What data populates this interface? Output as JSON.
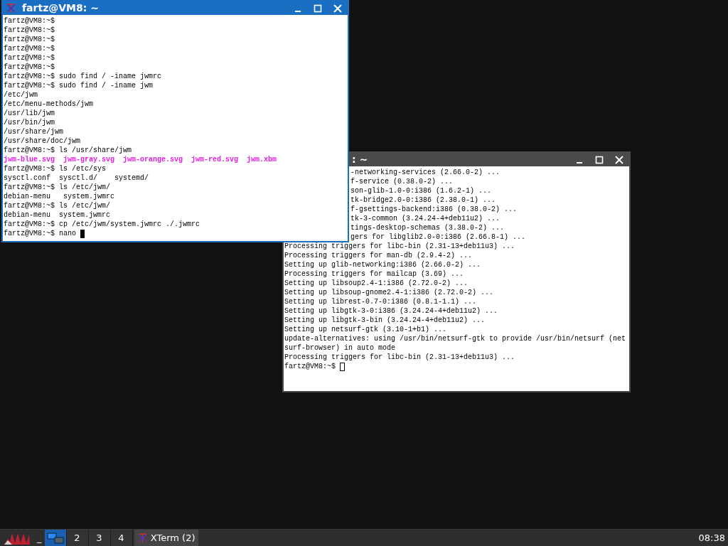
{
  "windows": [
    {
      "title": ": ~",
      "focused": false,
      "lines": [
        {
          "kind": "partial",
          "text": "-networking-services (2.66.0-2) ..."
        },
        {
          "kind": "partial",
          "text": "f-service (0.38.0-2) ..."
        },
        {
          "kind": "partial",
          "text": "son-glib-1.0-0:i386 (1.6.2-1) ..."
        },
        {
          "kind": "partial",
          "text": "tk-bridge2.0-0:i386 (2.38.0-1) ..."
        },
        {
          "kind": "partial",
          "text": "f-gsettings-backend:i386 (0.38.0-2) ..."
        },
        {
          "kind": "partial",
          "text": "tk-3-common (3.24.24-4+deb11u2) ..."
        },
        {
          "kind": "partial",
          "text": "tings-desktop-schemas (3.38.0-2) ..."
        },
        {
          "kind": "partial",
          "text": "gers for libglib2.0-0:i386 (2.66.8-1) ..."
        },
        {
          "kind": "text",
          "text": "Processing triggers for libc-bin (2.31-13+deb11u3) ..."
        },
        {
          "kind": "text",
          "text": "Processing triggers for man-db (2.9.4-2) ..."
        },
        {
          "kind": "text",
          "text": "Setting up glib-networking:i386 (2.66.0-2) ..."
        },
        {
          "kind": "text",
          "text": "Processing triggers for mailcap (3.69) ..."
        },
        {
          "kind": "text",
          "text": "Setting up libsoup2.4-1:i386 (2.72.0-2) ..."
        },
        {
          "kind": "text",
          "text": "Setting up libsoup-gnome2.4-1:i386 (2.72.0-2) ..."
        },
        {
          "kind": "text",
          "text": "Setting up librest-0.7-0:i386 (0.8.1-1.1) ..."
        },
        {
          "kind": "text",
          "text": "Setting up libgtk-3-0:i386 (3.24.24-4+deb11u2) ..."
        },
        {
          "kind": "text",
          "text": "Setting up libgtk-3-bin (3.24.24-4+deb11u2) ..."
        },
        {
          "kind": "text",
          "text": "Setting up netsurf-gtk (3.10-1+b1) ..."
        },
        {
          "kind": "text",
          "text": "update-alternatives: using /usr/bin/netsurf-gtk to provide /usr/bin/netsurf (net"
        },
        {
          "kind": "text",
          "text": "surf-browser) in auto mode"
        },
        {
          "kind": "text",
          "text": "Processing triggers for libc-bin (2.31-13+deb11u3) ..."
        },
        {
          "kind": "prompt",
          "text": "fartz@VM8:~$ "
        }
      ]
    },
    {
      "title": "fartz@VM8: ~",
      "focused": true,
      "lines": [
        {
          "kind": "text",
          "text": "fartz@VM8:~$"
        },
        {
          "kind": "text",
          "text": "fartz@VM8:~$"
        },
        {
          "kind": "text",
          "text": "fartz@VM8:~$"
        },
        {
          "kind": "text",
          "text": "fartz@VM8:~$"
        },
        {
          "kind": "text",
          "text": "fartz@VM8:~$"
        },
        {
          "kind": "text",
          "text": "fartz@VM8:~$"
        },
        {
          "kind": "text",
          "text": "fartz@VM8:~$ sudo find / -iname jwmrc"
        },
        {
          "kind": "text",
          "text": "fartz@VM8:~$ sudo find / -iname jwm"
        },
        {
          "kind": "text",
          "text": "/etc/jwm"
        },
        {
          "kind": "text",
          "text": "/etc/menu-methods/jwm"
        },
        {
          "kind": "text",
          "text": "/usr/lib/jwm"
        },
        {
          "kind": "text",
          "text": "/usr/bin/jwm"
        },
        {
          "kind": "text",
          "text": "/usr/share/jwm"
        },
        {
          "kind": "text",
          "text": "/usr/share/doc/jwm"
        },
        {
          "kind": "text",
          "text": "fartz@VM8:~$ ls /usr/share/jwm"
        },
        {
          "kind": "files",
          "items": [
            "jwm-blue.svg",
            "jwm-gray.svg",
            "jwm-orange.svg",
            "jwm-red.svg",
            "jwm.xbm"
          ]
        },
        {
          "kind": "text",
          "text": "fartz@VM8:~$ ls /etc/sys"
        },
        {
          "kind": "text",
          "text": "sysctl.conf  sysctl.d/    systemd/"
        },
        {
          "kind": "text",
          "text": "fartz@VM8:~$ ls /etc/jwm/"
        },
        {
          "kind": "text",
          "text": "debian-menu   system.jwmrc"
        },
        {
          "kind": "text",
          "text": "fartz@VM8:~$ ls /etc/jwm/"
        },
        {
          "kind": "text",
          "text": "debian-menu  system.jwmrc"
        },
        {
          "kind": "text",
          "text": "fartz@VM8:~$ cp /etc/jwm/system.jwmrc ./.jwmrc"
        },
        {
          "kind": "prompt",
          "text": "fartz@VM8:~$ nano "
        }
      ]
    }
  ],
  "taskbar": {
    "show_desktop": "_",
    "desktops": [
      {
        "selected": true
      },
      {
        "label": "2",
        "selected": false
      },
      {
        "label": "3",
        "selected": false
      },
      {
        "label": "4",
        "selected": false
      }
    ],
    "task": "XTerm (2)",
    "clock": "08:38"
  }
}
